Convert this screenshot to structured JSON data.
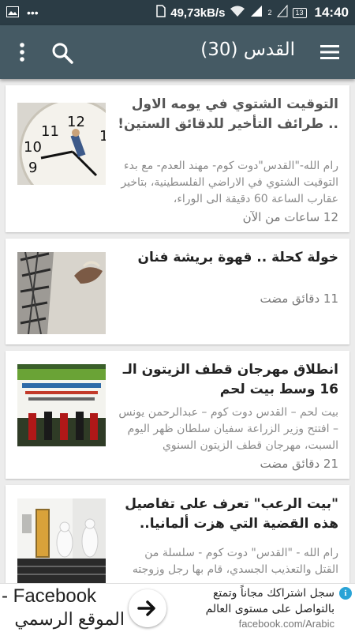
{
  "status_bar": {
    "net_speed": "49,73kB/s",
    "battery": "13",
    "time": "14:40",
    "sim_slot": "2"
  },
  "app_bar": {
    "title": "القدس (30)",
    "icons": [
      "menu-dots-icon",
      "search-icon",
      "hamburger-icon"
    ]
  },
  "articles": [
    {
      "title": "التوقيت الشتوي في يومه الاول .. طرائف التأخير للدقائق الستين!",
      "summary": "رام الله-\"القدس\"دوت كوم- مهند العدم- مع بدء التوقيت الشتوي في الاراضي الفلسطينية، بتاخير عقارب الساعة 60 دقيقة الى الوراء،",
      "time": "12 ساعات من الآن",
      "image": "clock-photo"
    },
    {
      "title": "خولة كحلة .. قهوة بريشة فنان",
      "summary": "",
      "time": "11 دقائق مضت",
      "image": "keffiyeh-painting"
    },
    {
      "title": "انطلاق مهرجان قطف الزيتون الـ 16 وسط بيت لحم",
      "summary": "بيت لحم – القدس دوت كوم – عبدالرحمن يونس – افتتح وزير الزراعة سفيان سلطان ظهر اليوم السبت، مهرجان قطف الزيتون السنوي",
      "time": "21 دقائق مضت",
      "image": "olive-festival-stage"
    },
    {
      "title": "\"بيت الرعب\" تعرف على تفاصيل هذه القضية التي هزت ألمانيا..",
      "summary": "رام الله - \"القدس\" دوت كوم - سلسلة من القتل والتعذيب الجسدي، قام بها رجل وزوجته",
      "time": "",
      "image": "forensics-house"
    }
  ],
  "ad": {
    "left_line1": "- Facebook",
    "left_line2": "الموقع الرسمي",
    "line1": "سجل اشتراكك مجاناً وتمتع",
    "line2": "بالتواصل على مستوى العالم",
    "url": "facebook.com/Arabic"
  }
}
